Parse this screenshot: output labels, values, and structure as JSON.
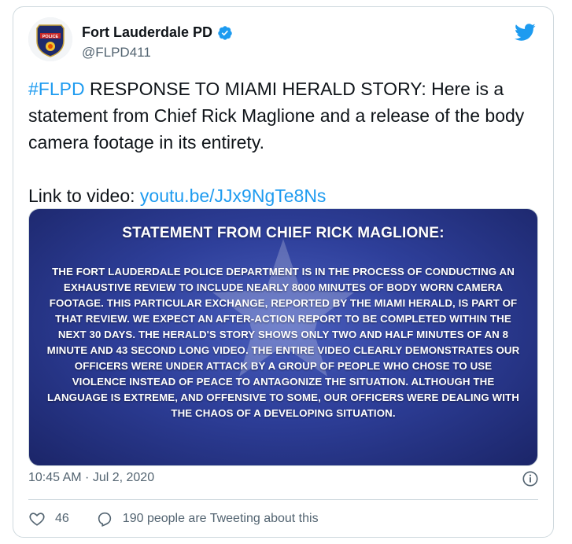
{
  "author": {
    "name": "Fort Lauderdale PD",
    "handle": "@FLPD411",
    "avatar_badge_text": "POLICE"
  },
  "tweet": {
    "hashtag": "#FLPD",
    "text_after_hashtag": " RESPONSE TO MIAMI HERALD STORY: Here is a statement from Chief Rick Maglione and a release of the body camera footage in its entirety.",
    "link_prefix": "Link to video: ",
    "link_text": "youtu.be/JJx9NgTe8Ns"
  },
  "media": {
    "title": "STATEMENT FROM CHIEF RICK MAGLIONE:",
    "body": "THE FORT LAUDERDALE POLICE DEPARTMENT IS IN THE PROCESS OF CONDUCTING AN EXHAUSTIVE REVIEW TO INCLUDE NEARLY 8000 MINUTES OF BODY WORN CAMERA FOOTAGE. THIS PARTICULAR EXCHANGE, REPORTED BY THE MIAMI HERALD, IS PART OF THAT REVIEW. WE EXPECT AN AFTER-ACTION REPORT TO BE COMPLETED WITHIN THE NEXT 30 DAYS. THE HERALD'S STORY SHOWS ONLY TWO AND HALF MINUTES OF AN 8 MINUTE AND 43 SECOND LONG VIDEO. THE ENTIRE VIDEO CLEARLY DEMONSTRATES OUR OFFICERS WERE UNDER ATTACK BY A GROUP OF PEOPLE WHO CHOSE TO USE VIOLENCE INSTEAD OF PEACE TO ANTAGONIZE THE SITUATION. ALTHOUGH THE LANGUAGE IS EXTREME, AND OFFENSIVE TO SOME, OUR OFFICERS WERE DEALING WITH THE CHAOS OF A DEVELOPING SITUATION."
  },
  "meta": {
    "timestamp": "10:45 AM · Jul 2, 2020"
  },
  "actions": {
    "likes": "46",
    "conversation": "190 people are Tweeting about this"
  },
  "colors": {
    "accent": "#1d9bf0",
    "muted": "#536471",
    "border": "#cfd9de"
  }
}
